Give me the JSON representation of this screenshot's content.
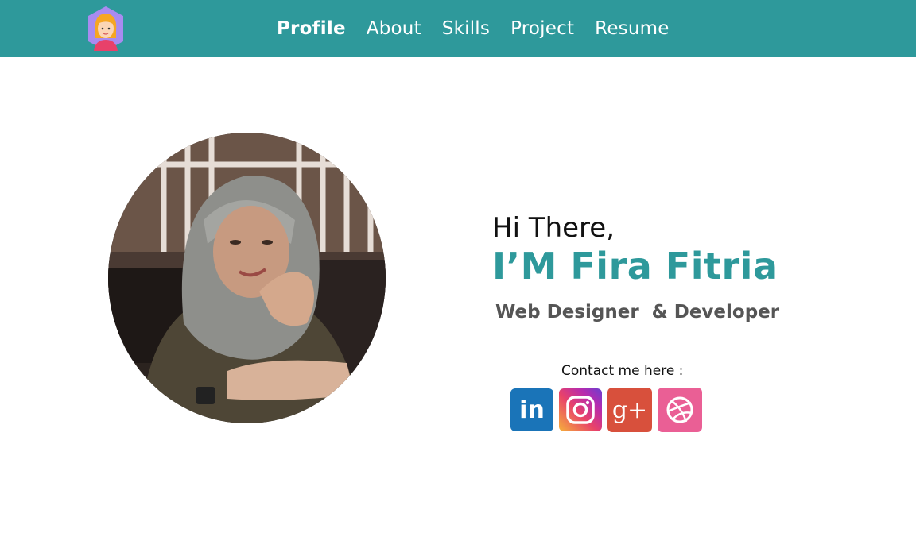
{
  "nav": {
    "logo_icon": "girl-avatar-icon",
    "items": [
      {
        "label": "Profile",
        "active": true
      },
      {
        "label": "About",
        "active": false
      },
      {
        "label": "Skills",
        "active": false
      },
      {
        "label": "Project",
        "active": false
      },
      {
        "label": "Resume",
        "active": false
      }
    ]
  },
  "hero": {
    "photo": "profile-photo",
    "greeting": "Hi There,",
    "name": "I’M Fira Fitria",
    "role": "Web Designer  & Developer",
    "contact_label": "Contact me here :",
    "socials": [
      {
        "icon": "linkedin-icon",
        "text": "in"
      },
      {
        "icon": "instagram-icon"
      },
      {
        "icon": "google-plus-icon",
        "text": "g+"
      },
      {
        "icon": "dribbble-icon"
      }
    ]
  },
  "colors": {
    "primary": "#2e999b",
    "text_dark": "#111111",
    "text_muted": "#555555"
  }
}
